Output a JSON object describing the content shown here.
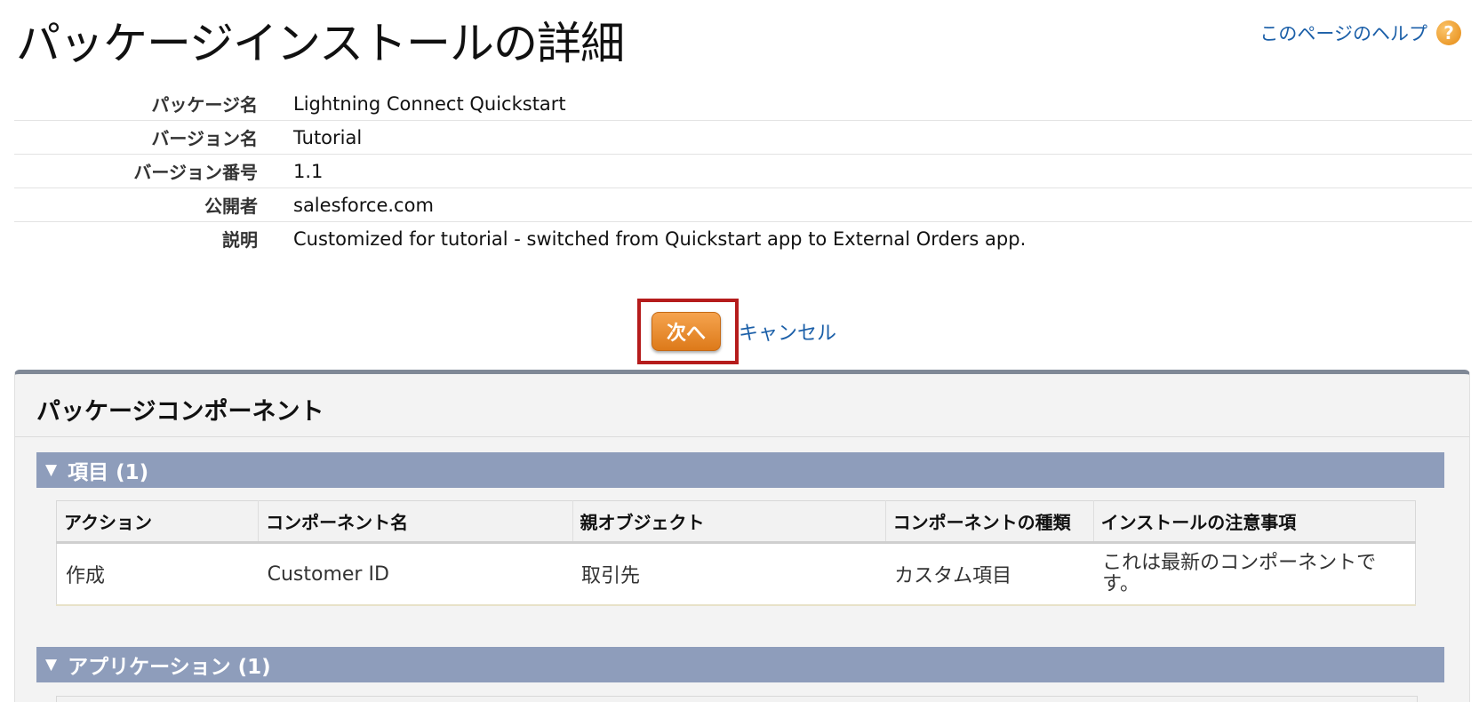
{
  "header": {
    "title": "パッケージインストールの詳細",
    "help_link": "このページのヘルプ",
    "help_icon_glyph": "?"
  },
  "details": [
    {
      "label": "パッケージ名",
      "value": "Lightning Connect Quickstart"
    },
    {
      "label": "バージョン名",
      "value": "Tutorial"
    },
    {
      "label": "バージョン番号",
      "value": "1.1"
    },
    {
      "label": "公開者",
      "value": "salesforce.com"
    },
    {
      "label": "説明",
      "value": "Customized for tutorial - switched from Quickstart app to External Orders app."
    }
  ],
  "actions": {
    "next_label": "次へ",
    "cancel_label": "キャンセル"
  },
  "components": {
    "title": "パッケージコンポーネント",
    "sections": [
      {
        "header": "項目 (1)",
        "columns": [
          "アクション",
          "コンポーネント名",
          "親オブジェクト",
          "コンポーネントの種類",
          "インストールの注意事項"
        ],
        "rows": [
          {
            "action": "作成",
            "name": "Customer ID",
            "parent": "取引先",
            "type": "カスタム項目",
            "note": "これは最新のコンポーネントです。"
          }
        ]
      },
      {
        "header": "アプリケーション (1)"
      }
    ]
  },
  "colors": {
    "link": "#1b5fa8",
    "primary_button": "#e8892a",
    "section_header": "#8e9dbb",
    "highlight_border": "#b51c1c"
  }
}
